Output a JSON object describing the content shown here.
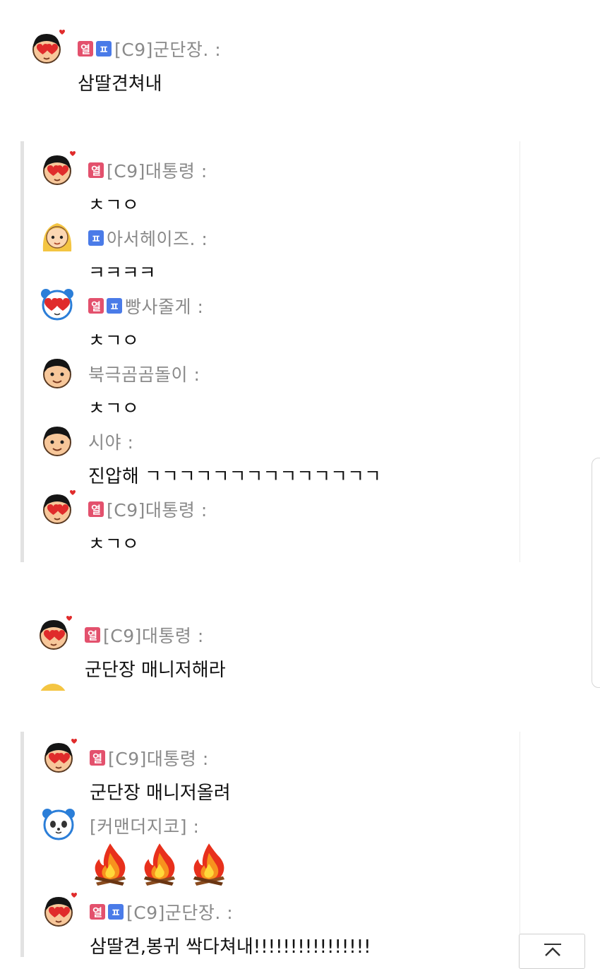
{
  "badges": {
    "red": "열",
    "blue": "ㅍ"
  },
  "blocks": [
    {
      "messages": [
        {
          "avatar": "heart-eyes-boy-icon",
          "badges": [
            "red",
            "blue"
          ],
          "name": "[C9]군단장. :",
          "text": "삼딸견쳐내"
        }
      ]
    },
    {
      "messages": [
        {
          "avatar": "heart-eyes-boy-icon",
          "badges": [
            "red"
          ],
          "name": "[C9]대통령 :",
          "text": "ㅊㄱㅇ"
        },
        {
          "avatar": "blonde-girl-icon",
          "badges": [
            "blue"
          ],
          "name": "아서헤이즈. :",
          "text": "ㅋㅋㅋㅋ"
        },
        {
          "avatar": "heart-eyes-panda-icon",
          "badges": [
            "red",
            "blue"
          ],
          "name": "빵사줄게 :",
          "text": "ㅊㄱㅇ"
        },
        {
          "avatar": "boy-icon",
          "badges": [],
          "name": "북극곰곰돌이 :",
          "text": "ㅊㄱㅇ"
        },
        {
          "avatar": "boy-icon",
          "badges": [],
          "name": "시야 :",
          "text": "진압해 ㄱㄱㄱㄱㄱㄱㄱㄱㄱㄱㄱㄱㄱㄱ"
        },
        {
          "avatar": "heart-eyes-boy-icon",
          "badges": [
            "red"
          ],
          "name": "[C9]대통령 :",
          "text": "ㅊㄱㅇ"
        }
      ]
    },
    {
      "messages": [
        {
          "avatar": "heart-eyes-boy-icon",
          "badges": [
            "red"
          ],
          "name": "[C9]대통령 :",
          "text": "군단장 매니저해라"
        }
      ]
    },
    {
      "messages": [
        {
          "avatar": "heart-eyes-boy-icon",
          "badges": [
            "red"
          ],
          "name": "[C9]대통령 :",
          "text": "군단장 매니저올려"
        },
        {
          "avatar": "panda-icon",
          "badges": [],
          "name": "[커맨더지코] :",
          "text": "",
          "emojis": [
            "campfire-icon",
            "campfire-icon",
            "campfire-icon"
          ]
        },
        {
          "avatar": "heart-eyes-boy-icon",
          "badges": [
            "red",
            "blue"
          ],
          "name": "[C9]군단장. :",
          "text": "삼딸견,봉귀 싹다쳐내!!!!!!!!!!!!!!!!"
        }
      ]
    }
  ],
  "scroll_top_icon": "arrow-up-icon"
}
